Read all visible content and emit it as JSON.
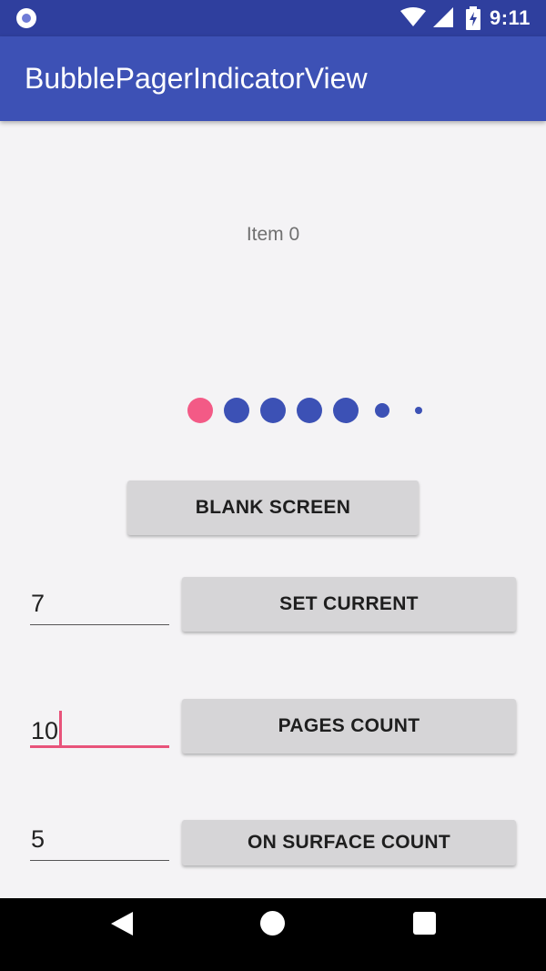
{
  "status_bar": {
    "time": "9:11",
    "icons": [
      "notification-icon",
      "wifi-icon",
      "signal-icon",
      "battery-icon"
    ]
  },
  "app_bar": {
    "title": "BubblePagerIndicatorView"
  },
  "pager": {
    "item_label": "Item 0"
  },
  "indicator": {
    "active_color": "#f35a86",
    "inactive_color": "#3c51b5"
  },
  "buttons": {
    "blank_screen": "Blank screen",
    "set_current": "Set current",
    "pages_count": "Pages count",
    "on_surface_count": "On surface count"
  },
  "fields": {
    "current": "7",
    "pages": "10",
    "surface": "5"
  },
  "nav_bar": {
    "icons": [
      "back-icon",
      "home-icon",
      "recents-icon"
    ]
  },
  "colors": {
    "primary": "#3d51b5",
    "primary_dark": "#2f3f9e",
    "accent": "#e8537a"
  }
}
